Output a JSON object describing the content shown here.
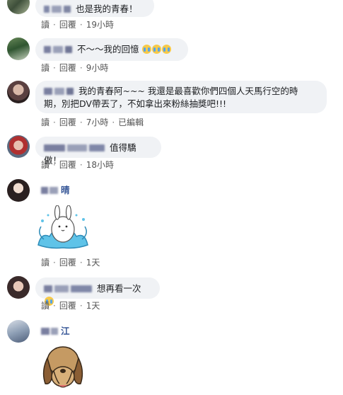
{
  "comments": [
    {
      "text": "也是我的青春！",
      "actions": {
        "reply_prefix": "讀",
        "reply": "回覆",
        "time": "19小時"
      }
    },
    {
      "text": "不～～我的回憶",
      "emoji": [
        "crying-emoji",
        "crying-emoji",
        "crying-emoji"
      ],
      "actions": {
        "reply_prefix": "讀",
        "reply": "回覆",
        "time": "9小時"
      }
    },
    {
      "text_line1": "我的青春阿~~~ 我還是最喜歡你們四個人天馬行空的時",
      "text_line2": "期，別把DV帶丟了，不如拿出來粉絲抽獎吧!!!",
      "actions": {
        "reply_prefix": "讀",
        "reply": "回覆",
        "time": "7小時",
        "edited": "已編輯"
      }
    },
    {
      "text": "值得驕傲！",
      "actions": {
        "reply_prefix": "讀",
        "reply": "回覆",
        "time": "18小時"
      }
    },
    {
      "name_suffix": "晴",
      "sticker": "rabbit-splash-sticker",
      "actions": {
        "reply_prefix": "讀",
        "reply": "回覆",
        "time": "1天"
      }
    },
    {
      "text": "想再看一次",
      "emoji": [
        "crying-emoji"
      ],
      "actions": {
        "reply_prefix": "讀",
        "reply": "回覆",
        "time": "1天"
      }
    },
    {
      "name_suffix": "江",
      "sticker": "dog-covering-face-sticker"
    }
  ],
  "colors": {
    "bubble": "#f0f2f5",
    "action_text": "#555555",
    "name_blur": "#7a7fa0"
  }
}
